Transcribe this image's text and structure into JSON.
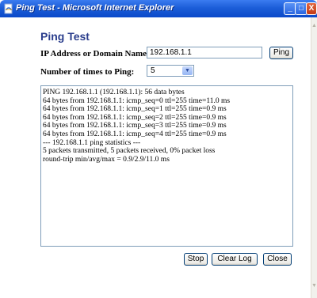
{
  "window": {
    "title": "Ping Test - Microsoft Internet Explorer",
    "title_icon": "ie-page-icon",
    "controls": {
      "minimize": "_",
      "maximize": "□",
      "close": "X"
    }
  },
  "page": {
    "heading": "Ping Test",
    "ip_label": "IP Address or Domain Name:",
    "ip_value": "192.168.1.1",
    "ping_button": "Ping",
    "times_label": "Number of times to Ping:",
    "times_value": "5",
    "log_lines": [
      "PING 192.168.1.1 (192.168.1.1): 56 data bytes",
      "64 bytes from 192.168.1.1: icmp_seq=0 ttl=255 time=11.0 ms",
      "64 bytes from 192.168.1.1: icmp_seq=1 ttl=255 time=0.9 ms",
      "64 bytes from 192.168.1.1: icmp_seq=2 ttl=255 time=0.9 ms",
      "64 bytes from 192.168.1.1: icmp_seq=3 ttl=255 time=0.9 ms",
      "64 bytes from 192.168.1.1: icmp_seq=4 ttl=255 time=0.9 ms",
      "--- 192.168.1.1 ping statistics ---",
      "5 packets transmitted, 5 packets received, 0% packet loss",
      "round-trip min/avg/max = 0.9/2.9/11.0 ms"
    ],
    "stop_button": "Stop",
    "clear_log_button": "Clear Log",
    "close_button": "Close"
  },
  "colors": {
    "titlebar": "#1c5ed8",
    "heading": "#2a3d8c",
    "button_border": "#003c74",
    "input_border": "#7f9db9"
  }
}
